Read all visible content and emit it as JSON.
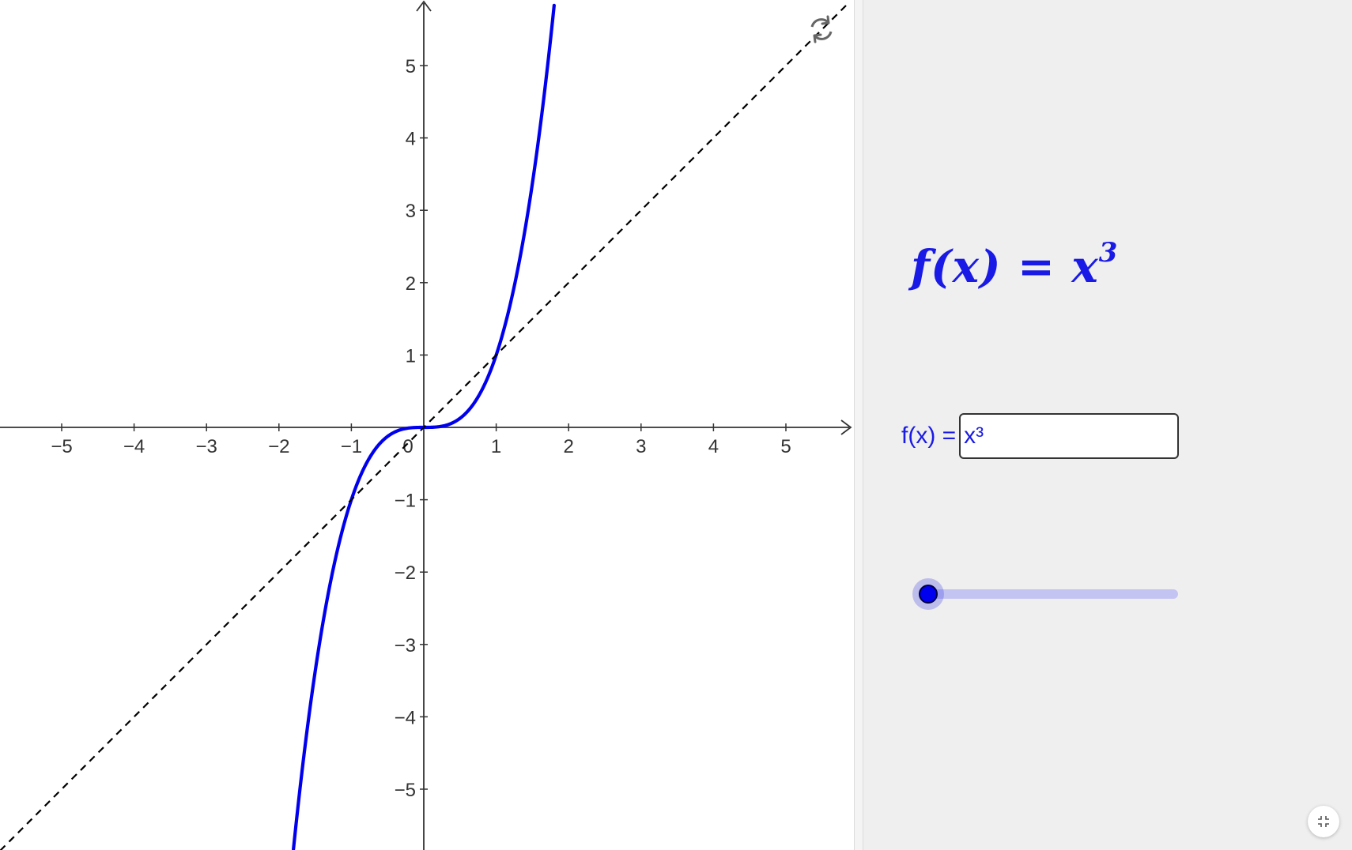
{
  "panel": {
    "formula_title": {
      "prefix": "f(x) = x",
      "exponent": "3"
    },
    "input": {
      "label": "f(x) =",
      "value": "x³"
    },
    "slider": {
      "value_fraction": 0.0
    }
  },
  "icons": {
    "reset": "reset-icon",
    "fullscreen": "exit-fullscreen-icon"
  },
  "colors": {
    "function_curve": "#0000ee",
    "reference_line": "#000000",
    "formula_text": "#1a1ae6",
    "slider_track": "#c4c4f2",
    "panel_background": "#efefef"
  },
  "chart_data": {
    "type": "line",
    "xlim": [
      -5.85,
      5.85
    ],
    "ylim": [
      -5.85,
      5.85
    ],
    "grid": false,
    "x_ticks": [
      -5,
      -4,
      -3,
      -2,
      -1,
      1,
      2,
      3,
      4,
      5
    ],
    "y_ticks": [
      -5,
      -4,
      -3,
      -2,
      -1,
      1,
      2,
      3,
      4,
      5
    ],
    "x_tick_labels": [
      "−5",
      "−4",
      "−3",
      "−2",
      "−1",
      "1",
      "2",
      "3",
      "4",
      "5"
    ],
    "y_tick_labels": [
      "−5",
      "−4",
      "−3",
      "−2",
      "−1",
      "1",
      "2",
      "3",
      "4",
      "5"
    ],
    "origin_label": "0",
    "series": [
      {
        "name": "f(x) = x³",
        "style": "solid",
        "x": [
          -1.8,
          -1.6,
          -1.4,
          -1.2,
          -1.0,
          -0.8,
          -0.6,
          -0.4,
          -0.2,
          0,
          0.2,
          0.4,
          0.6,
          0.8,
          1.0,
          1.2,
          1.4,
          1.6,
          1.8
        ],
        "y": [
          -5.832,
          -4.096,
          -2.744,
          -1.728,
          -1.0,
          -0.512,
          -0.216,
          -0.064,
          -0.008,
          0,
          0.008,
          0.064,
          0.216,
          0.512,
          1.0,
          1.728,
          2.744,
          4.096,
          5.832
        ]
      },
      {
        "name": "y = x",
        "style": "dashed",
        "x": [
          -5.85,
          5.85
        ],
        "y": [
          -5.85,
          5.85
        ]
      }
    ]
  }
}
